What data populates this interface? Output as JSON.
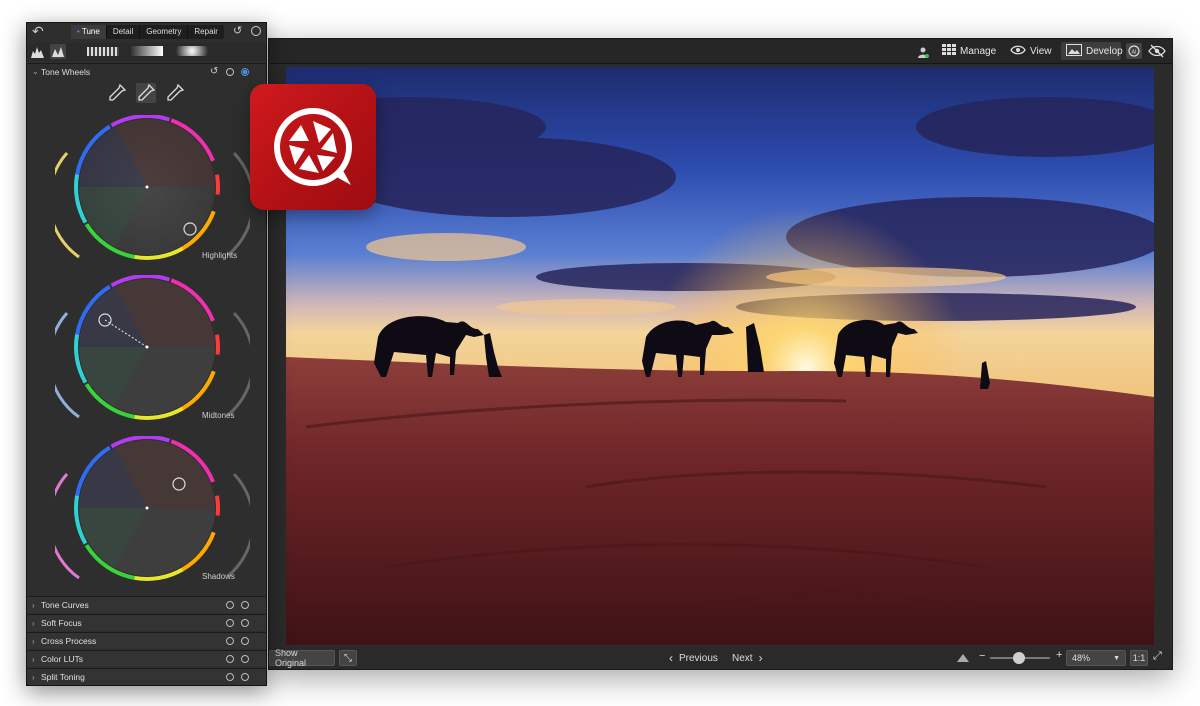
{
  "panel": {
    "tabs": [
      "Tune",
      "Detail",
      "Geometry",
      "Repair"
    ],
    "active_tab": "Tune",
    "section_title": "Tone Wheels",
    "wheels": [
      {
        "label": "Highlights"
      },
      {
        "label": "Midtones"
      },
      {
        "label": "Shadows"
      }
    ],
    "closed_sections": [
      "Tone Curves",
      "Soft Focus",
      "Cross Process",
      "Color LUTs",
      "Split Toning"
    ]
  },
  "topbar": {
    "manage": "Manage",
    "view": "View",
    "develop": "Develop",
    "active": "Develop"
  },
  "bottombar": {
    "show_original": "Show Original",
    "previous": "Previous",
    "next": "Next",
    "zoom": "48%",
    "zoom_fraction": 0.48,
    "one_to_one": "1:1"
  },
  "colors": {
    "app_icon": "#c4161b",
    "accent_blue": "#4a90e2"
  },
  "icons": [
    "undo-icon",
    "histogram-icon",
    "eyedropper-icon",
    "aperture-icon",
    "eye-icon",
    "grid-icon",
    "user-icon"
  ]
}
